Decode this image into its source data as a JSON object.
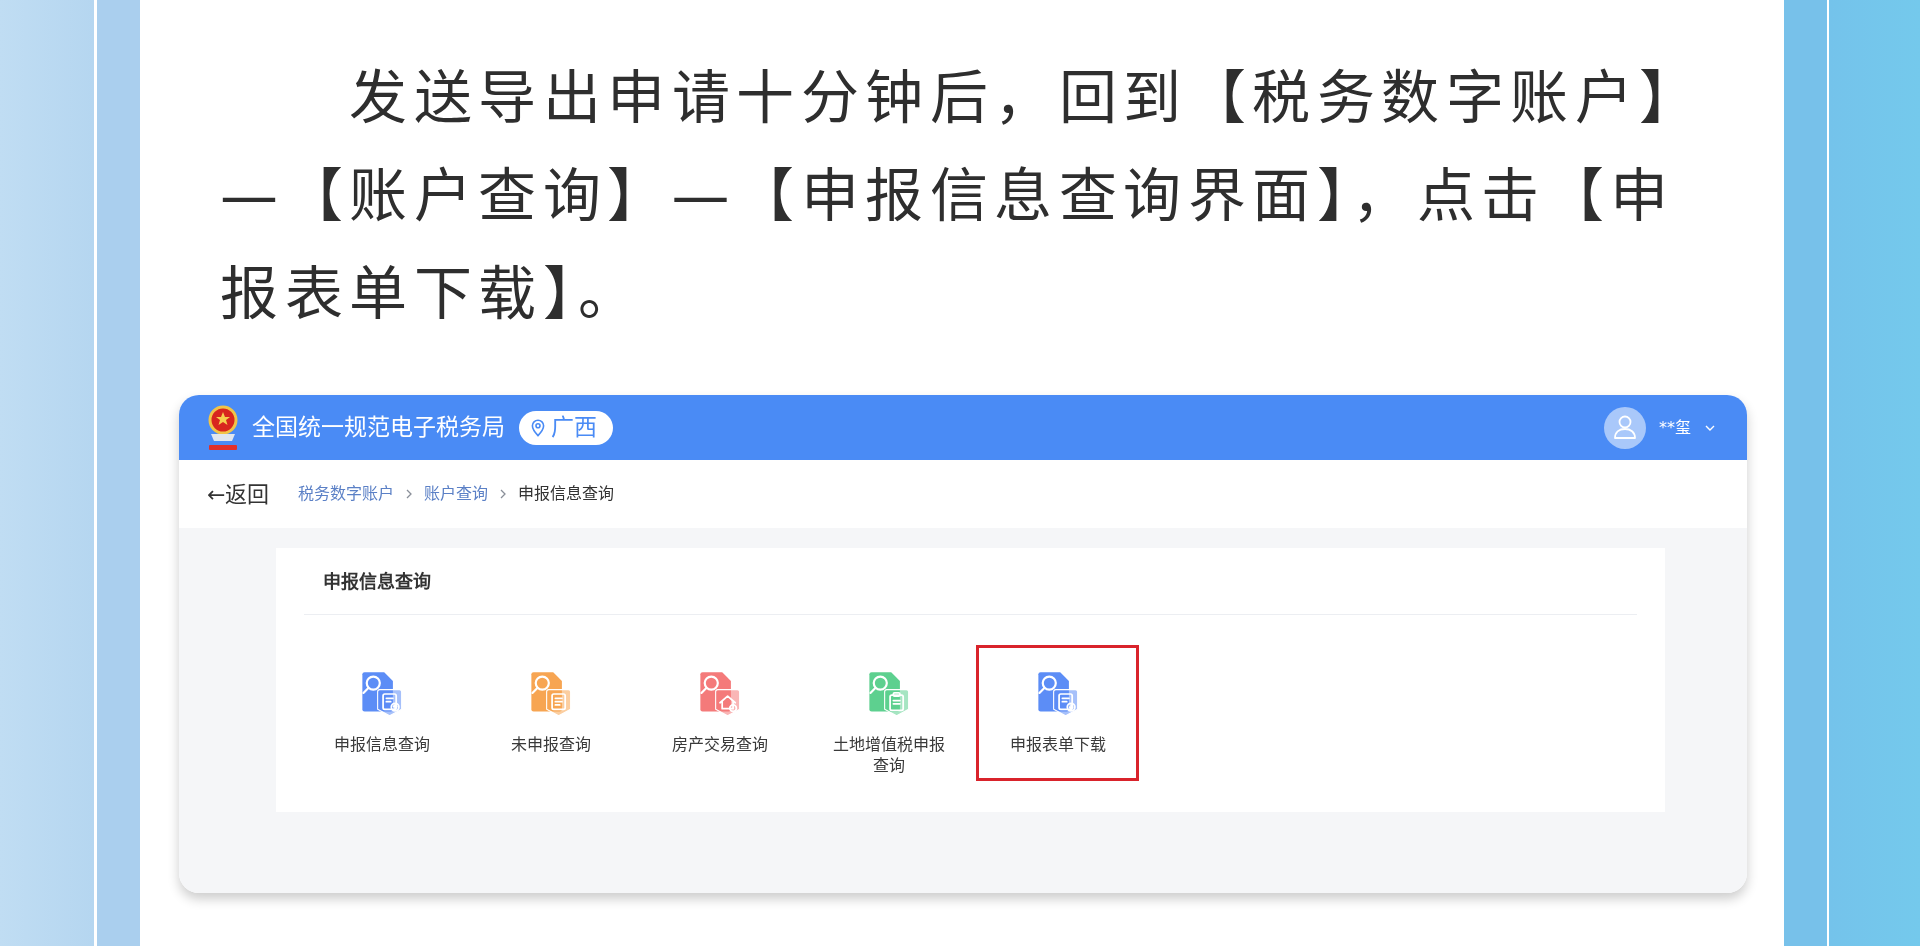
{
  "instruction": {
    "text": "发送导出申请十分钟后，回到【税务数字账户】—【账户查询】—【申报信息查询界面】，点击【申报表单下载】。"
  },
  "screenshot": {
    "header": {
      "title": "全国统一规范电子税务局",
      "region": "广西",
      "user": "**玺"
    },
    "back_link": "←返回",
    "breadcrumb": [
      {
        "label": "税务数字账户",
        "current": false
      },
      {
        "label": "账户查询",
        "current": false
      },
      {
        "label": "申报信息查询",
        "current": true
      }
    ],
    "panel": {
      "title": "申报信息查询",
      "items": [
        {
          "label": "申报信息查询",
          "kind": "upload",
          "color": "#5c8df6",
          "highlighted": false
        },
        {
          "label": "未申报查询",
          "kind": "list",
          "color": "#f7a552",
          "highlighted": false
        },
        {
          "label": "房产交易查询",
          "kind": "house",
          "color": "#f47a7a",
          "highlighted": false
        },
        {
          "label": "土地增值税申报查询",
          "kind": "clipboard",
          "color": "#5dd08f",
          "highlighted": false
        },
        {
          "label": "申报表单下载",
          "kind": "download",
          "color": "#5c8df6",
          "highlighted": true
        }
      ]
    }
  }
}
